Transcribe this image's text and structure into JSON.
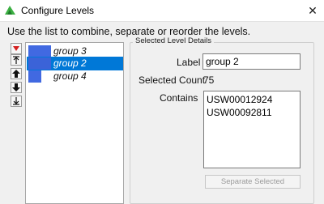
{
  "window": {
    "title": "Configure Levels",
    "close_glyph": "✕",
    "icon": "jmp-app-icon"
  },
  "instruction": "Use the list to combine, separate or reorder the levels.",
  "side_buttons": [
    {
      "name": "red-triangle-menu-icon"
    },
    {
      "name": "move-to-top-icon"
    },
    {
      "name": "move-up-icon"
    },
    {
      "name": "move-down-icon"
    },
    {
      "name": "move-to-bottom-icon"
    }
  ],
  "levels": [
    {
      "label": "group 3",
      "selected": false
    },
    {
      "label": "group 2",
      "selected": true
    },
    {
      "label": "group 4",
      "selected": false
    }
  ],
  "details": {
    "legend": "Selected Level Details",
    "label_caption": "Label",
    "label_value": "group 2",
    "count_caption": "Selected Count",
    "count_value": "75",
    "contains_caption": "Contains",
    "contains_items": [
      "USW00012924",
      "USW00092811"
    ],
    "separate_button": "Separate Selected"
  },
  "colors": {
    "selection": "#0078d7",
    "swatch": "#4169e1",
    "red_triangle": "#d42020",
    "app_icon": "#3cb043"
  }
}
